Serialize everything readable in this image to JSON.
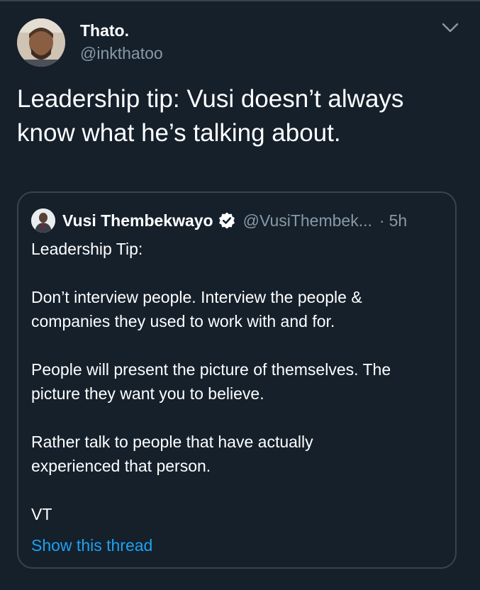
{
  "tweet": {
    "author_name": "Thato.",
    "author_handle": "@inkthatoo",
    "text_lines": [
      "Leadership tip: Vusi doesn’t always",
      "know what he’s talking about."
    ]
  },
  "quote": {
    "author_name": "Vusi Thembekwayo",
    "author_handle": "@VusiThembek...",
    "separator": "·",
    "time": "5h",
    "paragraphs": [
      [
        "Leadership Tip:"
      ],
      [
        "Don’t interview people. Interview the people &",
        "companies they used to work with and for."
      ],
      [
        "People will present the picture of themselves. The",
        "picture they want you to believe."
      ],
      [
        "Rather talk to people that have actually",
        "experienced that person."
      ],
      [
        "VT"
      ]
    ],
    "show_thread_label": "Show this thread"
  },
  "icons": {
    "caret": "chevron-down-icon",
    "verified": "verified-badge-icon"
  },
  "colors": {
    "background": "#15202b",
    "text": "#ffffff",
    "secondary_text": "#8899a6",
    "link": "#1da1f2",
    "border": "#38444d"
  }
}
